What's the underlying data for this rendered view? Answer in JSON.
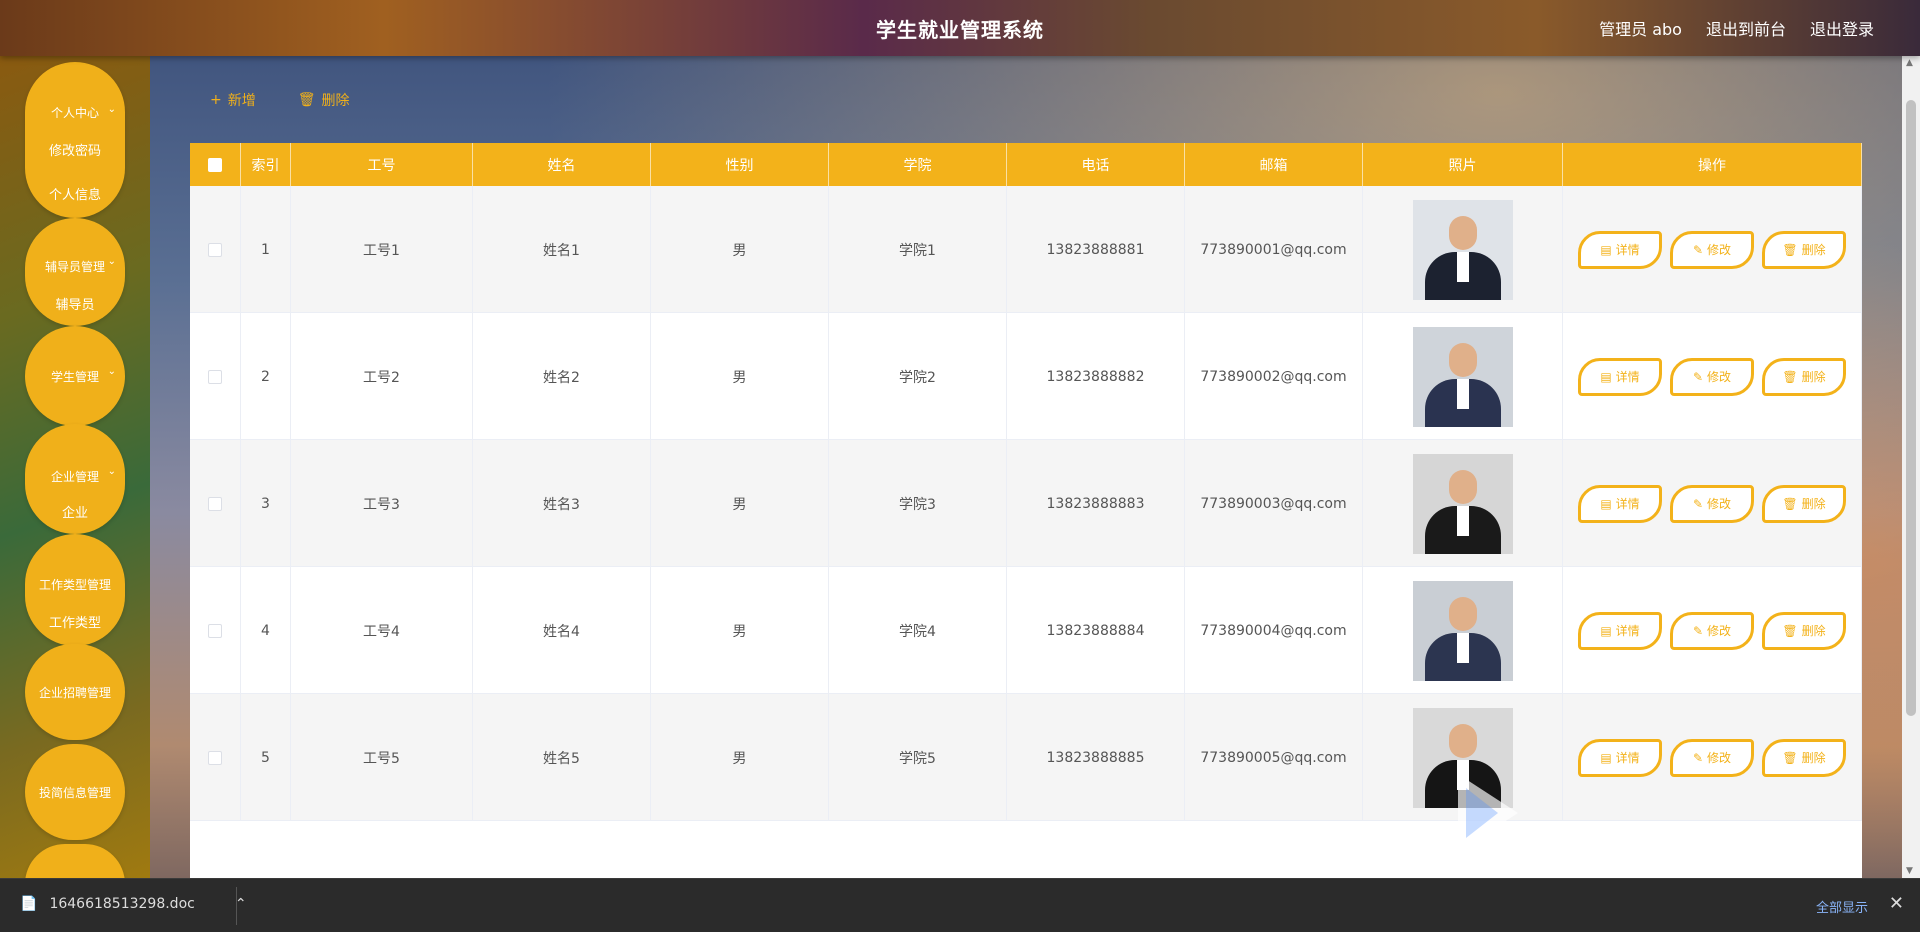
{
  "header": {
    "title": "学生就业管理系统",
    "user_label": "管理员 abo",
    "front_link": "退出到前台",
    "logout_link": "退出登录"
  },
  "sidebar": {
    "groups": [
      {
        "title": "个人中心",
        "items": [
          "修改密码",
          "个人信息"
        ]
      },
      {
        "title": "辅导员管理",
        "items": [
          "辅导员"
        ]
      },
      {
        "title": "学生管理",
        "items": []
      },
      {
        "title": "企业管理",
        "items": [
          "企业"
        ]
      },
      {
        "title": "工作类型管理",
        "items": [
          "工作类型"
        ]
      },
      {
        "title": "企业招聘管理",
        "items": []
      },
      {
        "title": "投简信息管理",
        "items": []
      }
    ]
  },
  "toolbar": {
    "add_label": "新增",
    "delete_label": "删除"
  },
  "table": {
    "headers": [
      "索引",
      "工号",
      "姓名",
      "性别",
      "学院",
      "电话",
      "邮箱",
      "照片",
      "操作"
    ],
    "rows": [
      {
        "index": "1",
        "job_no": "工号1",
        "name": "姓名1",
        "gender": "男",
        "college": "学院1",
        "phone": "13823888881",
        "email": "773890001@qq.com"
      },
      {
        "index": "2",
        "job_no": "工号2",
        "name": "姓名2",
        "gender": "男",
        "college": "学院2",
        "phone": "13823888882",
        "email": "773890002@qq.com"
      },
      {
        "index": "3",
        "job_no": "工号3",
        "name": "姓名3",
        "gender": "男",
        "college": "学院3",
        "phone": "13823888883",
        "email": "773890003@qq.com"
      },
      {
        "index": "4",
        "job_no": "工号4",
        "name": "姓名4",
        "gender": "男",
        "college": "学院4",
        "phone": "13823888884",
        "email": "773890004@qq.com"
      },
      {
        "index": "5",
        "job_no": "工号5",
        "name": "姓名5",
        "gender": "男",
        "college": "学院5",
        "phone": "13823888885",
        "email": "773890005@qq.com"
      }
    ],
    "actions": {
      "detail": "详情",
      "edit": "修改",
      "delete": "删除"
    }
  },
  "download_bar": {
    "file_name": "1646618513298.doc",
    "show_all": "全部显示"
  },
  "colors": {
    "accent": "#f3b21a",
    "header_bg": "#6b3a1a",
    "download_bar": "#2b2b2b"
  }
}
